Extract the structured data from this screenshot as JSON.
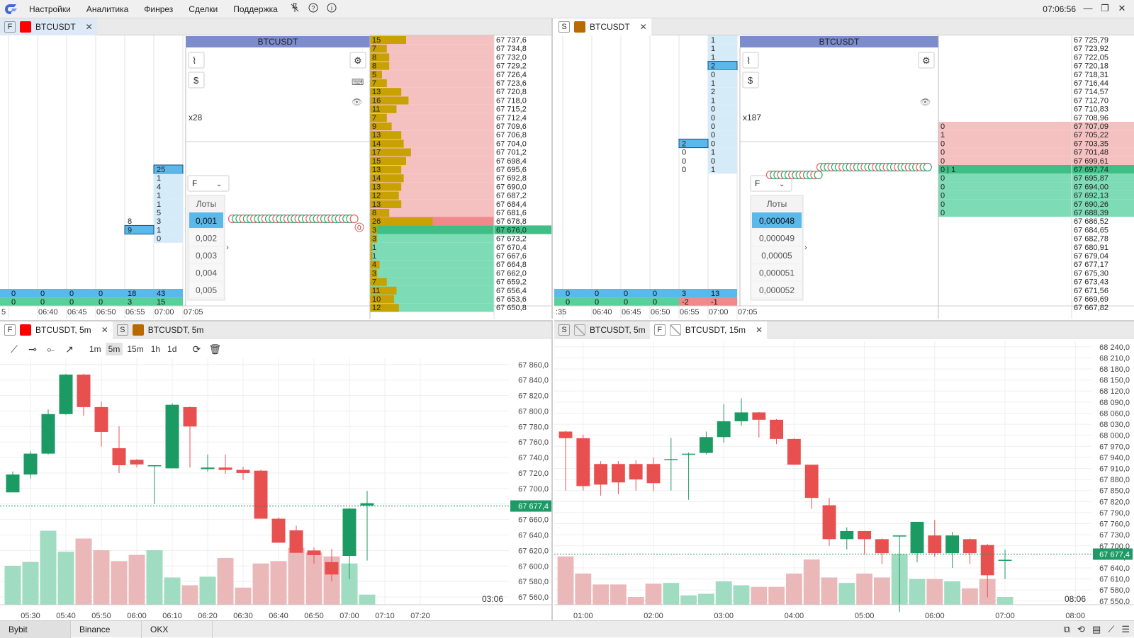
{
  "menubar": {
    "items": [
      "Настройки",
      "Аналитика",
      "Финрез",
      "Сделки",
      "Поддержка"
    ],
    "clock": "07:06:56",
    "icons": [
      "unpin-icon",
      "help-icon",
      "info-icon"
    ]
  },
  "colors": {
    "bid": "#7ddbb6",
    "ask": "#f5c0c0",
    "accent": "#1f8f5c",
    "red": "#e85050",
    "green": "#1b9a63",
    "gold": "#c8a200",
    "blue": "#5ab8ea",
    "header": "#7c8ccc"
  },
  "p1": {
    "tabs": [
      {
        "badge": "F",
        "label": "BTCUSDT",
        "color": "#ff0000"
      }
    ],
    "symbol": "BTCUSDT",
    "mult": "x28",
    "mode": "F",
    "lots_label": "Лоты",
    "lots": [
      "0,001",
      "0,002",
      "0,003",
      "0,004",
      "0,005"
    ],
    "ladder": [
      {
        "v": "15",
        "p": "67 737,6"
      },
      {
        "v": "7",
        "p": "67 734,8"
      },
      {
        "v": "8",
        "p": "67 732,0"
      },
      {
        "v": "8",
        "p": "67 729,2"
      },
      {
        "v": "5",
        "p": "67 726,4"
      },
      {
        "v": "7",
        "p": "67 723,6"
      },
      {
        "v": "13",
        "p": "67 720,8"
      },
      {
        "v": "16",
        "p": "67 718,0"
      },
      {
        "v": "11",
        "p": "67 715,2"
      },
      {
        "v": "7",
        "p": "67 712,4"
      },
      {
        "v": "9",
        "p": "67 709,6"
      },
      {
        "v": "13",
        "p": "67 706,8"
      },
      {
        "v": "14",
        "p": "67 704,0"
      },
      {
        "v": "17",
        "p": "67 701,2"
      },
      {
        "v": "15",
        "p": "67 698,4"
      },
      {
        "v": "13",
        "p": "67 695,6"
      },
      {
        "v": "14",
        "p": "67 692,8"
      },
      {
        "v": "13",
        "p": "67 690,0"
      },
      {
        "v": "12",
        "p": "67 687,2"
      },
      {
        "v": "13",
        "p": "67 684,4"
      },
      {
        "v": "8",
        "p": "67 681,6"
      },
      {
        "v": "26",
        "p": "67 678,8"
      },
      {
        "v": "3",
        "p": "67 676,0"
      },
      {
        "v": "3",
        "p": "67 673,2"
      },
      {
        "v": "1",
        "p": "67 670,4"
      },
      {
        "v": "1",
        "p": "67 667,6"
      },
      {
        "v": "4",
        "p": "67 664,8"
      },
      {
        "v": "3",
        "p": "67 662,0"
      },
      {
        "v": "7",
        "p": "67 659,2"
      },
      {
        "v": "11",
        "p": "67 656,4"
      },
      {
        "v": "10",
        "p": "67 653,6"
      },
      {
        "v": "12",
        "p": "67 650,8"
      }
    ],
    "cluster_col6": [
      "25",
      "1",
      "4",
      "1",
      "1",
      "5",
      "3",
      "1",
      "0"
    ],
    "cluster_col5": [
      "8",
      "9"
    ],
    "totals_row1": [
      "0",
      "0",
      "0",
      "0",
      "18",
      "43"
    ],
    "totals_row2": [
      "0",
      "0",
      "0",
      "0",
      "3",
      "15"
    ],
    "times": [
      "5",
      "06:40",
      "06:45",
      "06:50",
      "06:55",
      "07:00",
      "07:05"
    ],
    "bubble_label": "0"
  },
  "p2": {
    "tabs": [
      {
        "badge": "S",
        "label": "BTCUSDT",
        "color": "#b86a00"
      }
    ],
    "symbol": "BTCUSDT",
    "mult": "x187",
    "mode": "F",
    "lots_label": "Лоты",
    "lots": [
      "0,000048",
      "0,000049",
      "0,00005",
      "0,000051",
      "0,000052"
    ],
    "ladder": [
      {
        "v": "",
        "p": "67 725,79"
      },
      {
        "v": "",
        "p": "67 723,92"
      },
      {
        "v": "",
        "p": "67 722,05"
      },
      {
        "v": "",
        "p": "67 720,18"
      },
      {
        "v": "",
        "p": "67 718,31"
      },
      {
        "v": "",
        "p": "67 716,44"
      },
      {
        "v": "",
        "p": "67 714,57"
      },
      {
        "v": "",
        "p": "67 712,70"
      },
      {
        "v": "",
        "p": "67 710,83"
      },
      {
        "v": "",
        "p": "67 708,96"
      },
      {
        "v": "0",
        "p": "67 707,09"
      },
      {
        "v": "1",
        "p": "67 705,22"
      },
      {
        "v": "0",
        "p": "67 703,35"
      },
      {
        "v": "0",
        "p": "67 701,48"
      },
      {
        "v": "0",
        "p": "67 699,61"
      },
      {
        "v": "0 | 1",
        "p": "67 697,74"
      },
      {
        "v": "0",
        "p": "67 695,87"
      },
      {
        "v": "0",
        "p": "67 694,00"
      },
      {
        "v": "0",
        "p": "67 692,13"
      },
      {
        "v": "0",
        "p": "67 690,26"
      },
      {
        "v": "0",
        "p": "67 688,39"
      },
      {
        "v": "",
        "p": "67 686,52"
      },
      {
        "v": "",
        "p": "67 684,65"
      },
      {
        "v": "",
        "p": "67 682,78"
      },
      {
        "v": "",
        "p": "67 680,91"
      },
      {
        "v": "",
        "p": "67 679,04"
      },
      {
        "v": "",
        "p": "67 677,17"
      },
      {
        "v": "",
        "p": "67 675,30"
      },
      {
        "v": "",
        "p": "67 673,43"
      },
      {
        "v": "",
        "p": "67 671,56"
      },
      {
        "v": "",
        "p": "67 669,69"
      },
      {
        "v": "",
        "p": "67 667,82"
      }
    ],
    "cluster_col6": [
      "1",
      "1",
      "1",
      "2",
      "0",
      "1",
      "2",
      "1",
      "0",
      "0",
      "0",
      "0",
      "0",
      "1",
      "0",
      "1"
    ],
    "cluster_col5": [
      "2",
      "0",
      "0",
      "0"
    ],
    "totals_row1": [
      "0",
      "0",
      "0",
      "0",
      "3",
      "13"
    ],
    "totals_row2": [
      "0",
      "0",
      "0",
      "0",
      "-2",
      "-1"
    ],
    "times": [
      ":35",
      "06:40",
      "06:45",
      "06:50",
      "06:55",
      "07:00",
      "07:05"
    ]
  },
  "p3": {
    "tabs": [
      {
        "badge": "F",
        "label": "BTCUSDT, 5m",
        "color": "#ff0000"
      },
      {
        "badge": "S",
        "label": "BTCUSDT, 5m",
        "color": "#b86a00"
      }
    ],
    "timeframes": [
      "1m",
      "5m",
      "15m",
      "1h",
      "1d"
    ],
    "selected_tf": "5m",
    "countdown": "03:06",
    "last_price": "67 677,4",
    "chart_data": {
      "type": "candlestick",
      "x": [
        "05:25",
        "05:30",
        "05:35",
        "05:40",
        "05:45",
        "05:50",
        "05:55",
        "06:00",
        "06:05",
        "06:10",
        "06:15",
        "06:20",
        "06:25",
        "06:30",
        "06:35",
        "06:40",
        "06:45",
        "06:50",
        "06:55",
        "07:00",
        "07:05"
      ],
      "open": [
        67695,
        67718,
        67745,
        67796,
        67847,
        67805,
        67752,
        67737,
        67730,
        67726,
        67805,
        67725,
        67727,
        67724,
        67723,
        67661,
        67646,
        67620,
        67605,
        67613,
        67678
      ],
      "close": [
        67718,
        67745,
        67796,
        67847,
        67805,
        67773,
        67730,
        67731,
        67730,
        67808,
        67780,
        67727,
        67724,
        67720,
        67661,
        67630,
        67617,
        67614,
        67589,
        67674,
        67681
      ],
      "high": [
        67722,
        67748,
        67802,
        67848,
        67848,
        67812,
        67780,
        67738,
        67730,
        67810,
        67806,
        67744,
        67744,
        67728,
        67724,
        67663,
        67652,
        67624,
        67622,
        67675,
        67697
      ],
      "low": [
        67695,
        67713,
        67744,
        67795,
        67794,
        67754,
        67720,
        67727,
        67680,
        67728,
        67727,
        67722,
        67719,
        67711,
        67719,
        67650,
        67622,
        67603,
        67580,
        67583,
        67607
      ],
      "volume": [
        50,
        55,
        95,
        68,
        85,
        70,
        56,
        64,
        70,
        35,
        25,
        36,
        60,
        22,
        53,
        56,
        73,
        67,
        62,
        53,
        13
      ],
      "yticks": [
        "67 860,0",
        "67 840,0",
        "67 820,0",
        "67 800,0",
        "67 780,0",
        "67 760,0",
        "67 740,0",
        "67 720,0",
        "67 700,0",
        "67 680,0",
        "67 660,0",
        "67 640,0",
        "67 620,0",
        "67 600,0",
        "67 580,0",
        "67 560,0"
      ],
      "yvals": [
        67860,
        67840,
        67820,
        67800,
        67780,
        67760,
        67740,
        67720,
        67700,
        67680,
        67660,
        67640,
        67620,
        67600,
        67580,
        67560
      ],
      "xticks": [
        "05:30",
        "05:40",
        "05:50",
        "06:00",
        "06:10",
        "06:20",
        "06:30",
        "06:40",
        "06:50",
        "07:00",
        "07:10",
        "07:20"
      ],
      "ylim": [
        67550,
        67868
      ]
    }
  },
  "p4": {
    "tabs": [
      {
        "badge": "S",
        "label": "BTCUSDT, 5m"
      },
      {
        "badge": "F",
        "label": "BTCUSDT, 15m"
      }
    ],
    "countdown": "08:06",
    "last_price": "67 677,4",
    "chart_data": {
      "type": "candlestick",
      "x": [
        "00:45",
        "01:00",
        "01:15",
        "01:30",
        "01:45",
        "02:00",
        "02:15",
        "02:30",
        "02:45",
        "03:00",
        "03:15",
        "03:30",
        "03:45",
        "04:00",
        "04:15",
        "04:30",
        "04:45",
        "05:00",
        "05:15",
        "05:30",
        "05:45",
        "06:00",
        "06:15",
        "06:30",
        "06:45",
        "07:00"
      ],
      "open": [
        68010,
        67992,
        67922,
        67922,
        67922,
        67922,
        67935,
        67950,
        67952,
        67995,
        68038,
        68062,
        68042,
        67990,
        67920,
        67810,
        67718,
        67740,
        67718,
        67728,
        67680,
        67728,
        67680,
        67718,
        67702,
        67662
      ],
      "close": [
        67992,
        67862,
        67866,
        67872,
        67880,
        67870,
        67935,
        67950,
        67995,
        68038,
        68062,
        68042,
        67990,
        67920,
        67830,
        67718,
        67740,
        67718,
        67680,
        67728,
        67765,
        67680,
        67728,
        67680,
        67620,
        67662
      ],
      "high": [
        68012,
        68002,
        67930,
        67930,
        67932,
        67940,
        67993,
        67953,
        68010,
        68085,
        68100,
        68063,
        68044,
        67992,
        67920,
        67830,
        67750,
        67740,
        67720,
        67728,
        67765,
        67770,
        67738,
        67720,
        67705,
        67690
      ],
      "low": [
        67850,
        67850,
        67836,
        67840,
        67850,
        67849,
        67850,
        67825,
        67948,
        67980,
        68026,
        67994,
        67976,
        67920,
        67800,
        67700,
        67690,
        67676,
        67650,
        67520,
        67655,
        67670,
        67640,
        67650,
        67560,
        67610
      ],
      "volume": [
        62,
        40,
        26,
        26,
        10,
        27,
        28,
        12,
        14,
        30,
        25,
        23,
        23,
        40,
        58,
        35,
        28,
        40,
        35,
        65,
        33,
        33,
        30,
        21,
        33,
        10
      ],
      "yticks": [
        "68 240,0",
        "68 210,0",
        "68 180,0",
        "68 150,0",
        "68 120,0",
        "68 090,0",
        "68 060,0",
        "68 030,0",
        "68 000,0",
        "67 970,0",
        "67 940,0",
        "67 910,0",
        "67 880,0",
        "67 850,0",
        "67 820,0",
        "67 790,0",
        "67 760,0",
        "67 730,0",
        "67 700,0",
        "67 670,0",
        "67 640,0",
        "67 610,0",
        "67 580,0",
        "67 550,0"
      ],
      "yvals": [
        68240,
        68210,
        68180,
        68150,
        68120,
        68090,
        68060,
        68030,
        68000,
        67970,
        67940,
        67910,
        67880,
        67850,
        67820,
        67790,
        67760,
        67730,
        67700,
        67670,
        67640,
        67610,
        67580,
        67550
      ],
      "xticks": [
        "01:00",
        "02:00",
        "03:00",
        "04:00",
        "05:00",
        "06:00",
        "07:00",
        "08:00"
      ],
      "ylim": [
        67540,
        68255
      ]
    }
  },
  "statusbar": {
    "exchanges": [
      "Bybit",
      "Binance",
      "OKX"
    ]
  }
}
